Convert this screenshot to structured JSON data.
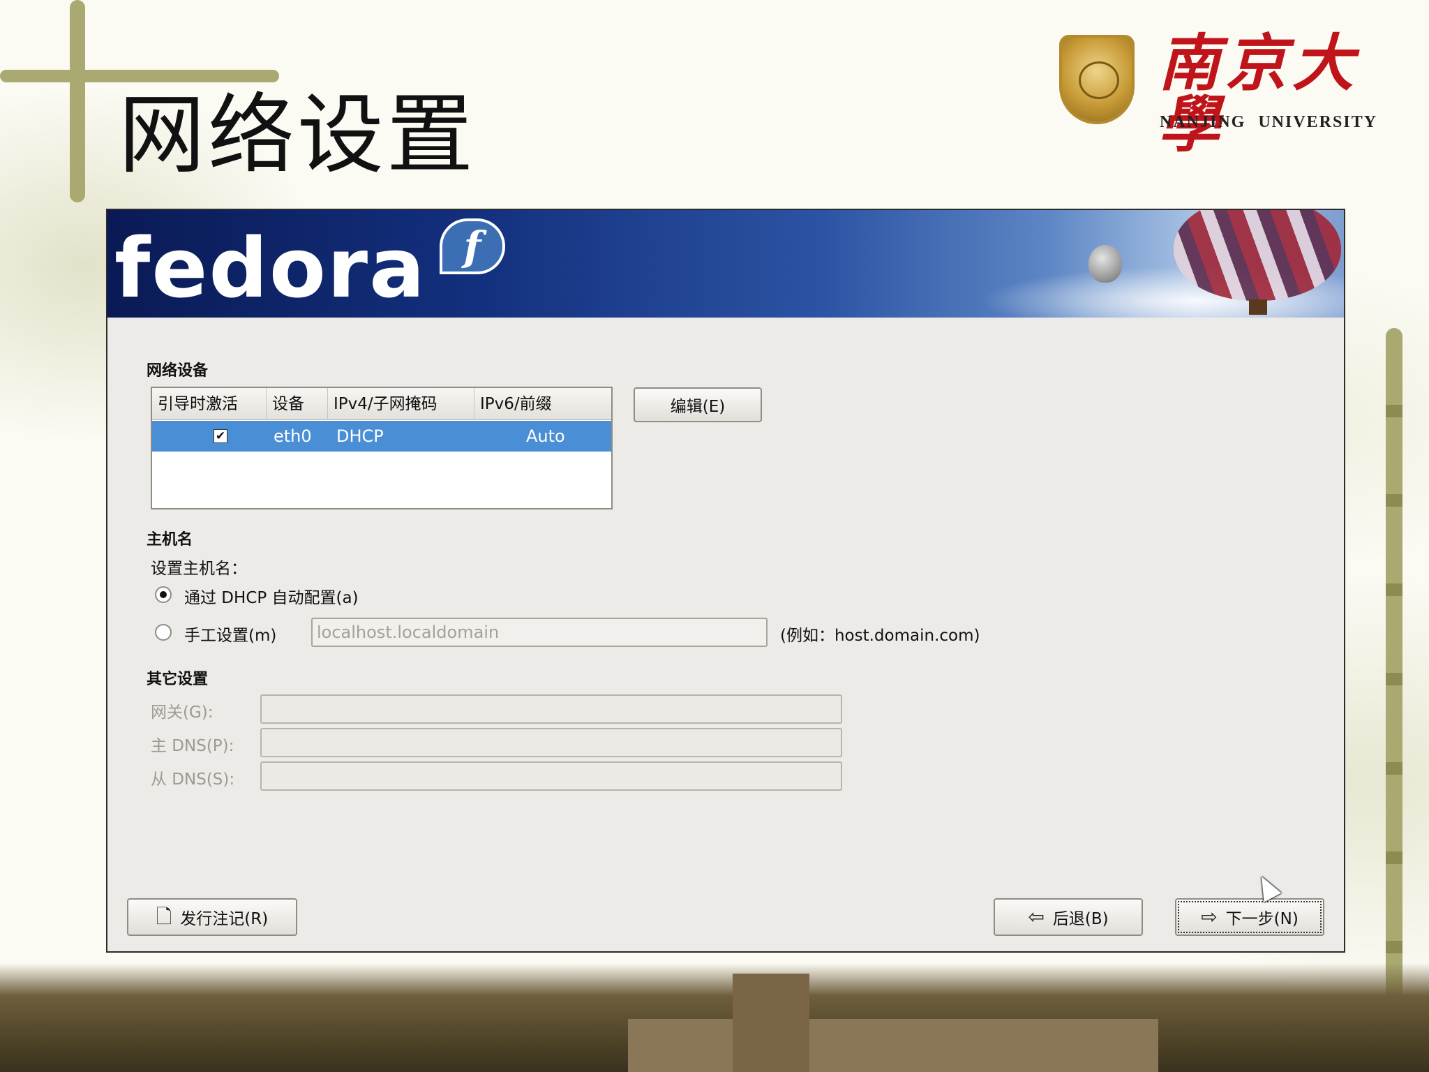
{
  "slide": {
    "title": "网络设置",
    "university_cn": "南京大學",
    "university_en": "NANJING UNIVERSITY"
  },
  "banner": {
    "brand": "fedora",
    "badge": "f"
  },
  "network_devices": {
    "section_label": "网络设备",
    "columns": [
      "引导时激活",
      "设备",
      "IPv4/子网掩码",
      "IPv6/前缀"
    ],
    "rows": [
      {
        "active": "✔",
        "device": "eth0",
        "ipv4": "DHCP",
        "ipv6": "Auto",
        "selected": true
      }
    ],
    "edit_button": "编辑(E)"
  },
  "hostname": {
    "section_label": "主机名",
    "prompt": "设置主机名：",
    "option_dhcp": "通过 DHCP 自动配置(a)",
    "option_manual": "手工设置(m)",
    "manual_placeholder": "localhost.localdomain",
    "example": "(例如：host.domain.com)",
    "selected_option": "dhcp"
  },
  "other_settings": {
    "section_label": "其它设置",
    "gateway_label": "网关(G):",
    "primary_dns_label": "主 DNS(P):",
    "secondary_dns_label": "从 DNS(S):"
  },
  "footer": {
    "release_notes_button": "发行注记(R)",
    "back_button": "后退(B)",
    "next_button": "下一步(N)"
  },
  "colors": {
    "selection": "#4a8fd6",
    "brand_red": "#c0141b",
    "window_bg": "#edebe7"
  },
  "icons": {
    "release_notes": "document-icon",
    "back": "arrow-left-icon",
    "next": "arrow-right-icon",
    "pointer": "mouse-cursor-icon"
  }
}
